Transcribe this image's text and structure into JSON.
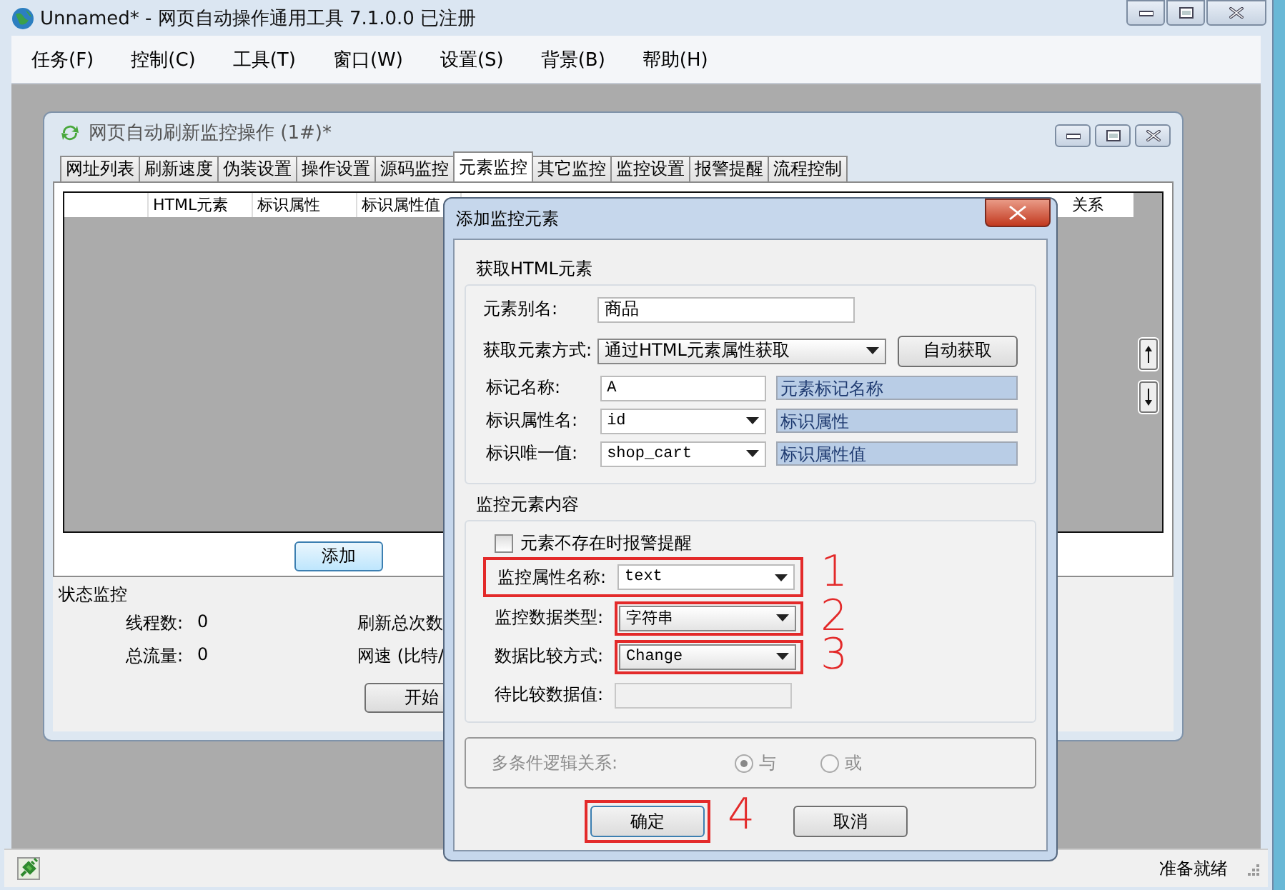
{
  "app": {
    "title": "Unnamed* - 网页自动操作通用工具 7.1.0.0  已注册"
  },
  "menu": [
    "任务(F)",
    "控制(C)",
    "工具(T)",
    "窗口(W)",
    "设置(S)",
    "背景(B)",
    "帮助(H)"
  ],
  "child_window": {
    "title": "网页自动刷新监控操作  (1#)*",
    "tabs": [
      {
        "label": "网址列表",
        "selected": false
      },
      {
        "label": "刷新速度",
        "selected": false
      },
      {
        "label": "伪装设置",
        "selected": false
      },
      {
        "label": "操作设置",
        "selected": false
      },
      {
        "label": "源码监控",
        "selected": false
      },
      {
        "label": "元素监控",
        "selected": true
      },
      {
        "label": "其它监控",
        "selected": false
      },
      {
        "label": "监控设置",
        "selected": false
      },
      {
        "label": "报警提醒",
        "selected": false
      },
      {
        "label": "流程控制",
        "selected": false
      }
    ],
    "columns": [
      "HTML元素",
      "标识属性",
      "标识属性值"
    ],
    "last_column": "关系",
    "add_button": "添加",
    "status_group": {
      "title": "状态监控",
      "items": [
        {
          "label": "线程数:",
          "value": "0"
        },
        {
          "label": "刷新总次数"
        },
        {
          "label": "总流量:",
          "value": "0"
        },
        {
          "label": "网速 (比特/"
        }
      ]
    },
    "start_button": "开始"
  },
  "dialog": {
    "title": "添加监控元素",
    "fetch_group": {
      "title": "获取HTML元素",
      "alias": {
        "label": "元素别名:",
        "value": "商品"
      },
      "method": {
        "label": "获取元素方式:",
        "value": "通过HTML元素属性获取",
        "button": "自动获取"
      },
      "rows": [
        {
          "label": "标记名称:",
          "value": "A",
          "kind": "text",
          "hint": "元素标记名称"
        },
        {
          "label": "标识属性名:",
          "value": "id",
          "kind": "combo",
          "hint": "标识属性"
        },
        {
          "label": "标识唯一值:",
          "value": "shop_cart",
          "kind": "combo",
          "hint": "标识属性值"
        }
      ]
    },
    "content_group": {
      "title": "监控元素内容",
      "alert_checkbox": {
        "label": "元素不存在时报警提醒",
        "checked": false
      },
      "rows": [
        {
          "label": "监控属性名称:",
          "value": "text",
          "kind": "combo",
          "disabled": false,
          "highlight": true,
          "highlight_label": true,
          "note": "1"
        },
        {
          "label": "监控数据类型:",
          "value": "字符串",
          "kind": "dropdown",
          "disabled": false,
          "highlight": true,
          "highlight_label": false,
          "note": "2"
        },
        {
          "label": "数据比较方式:",
          "value": "Change",
          "kind": "dropdown",
          "disabled": false,
          "highlight": true,
          "highlight_label": false,
          "note": "3"
        },
        {
          "label": "待比较数据值:",
          "kind": "text",
          "disabled": true,
          "highlight": false,
          "highlight_label": false
        }
      ]
    },
    "logic": {
      "label": "多条件逻辑关系:",
      "disabled": true,
      "options": [
        {
          "label": "与",
          "selected": true
        },
        {
          "label": "或",
          "selected": false
        }
      ]
    },
    "buttons": [
      {
        "label": "确定",
        "highlight": true,
        "note": "4"
      },
      {
        "label": "取消",
        "highlight": false
      }
    ]
  },
  "status_bar": {
    "text": "准备就绪"
  }
}
